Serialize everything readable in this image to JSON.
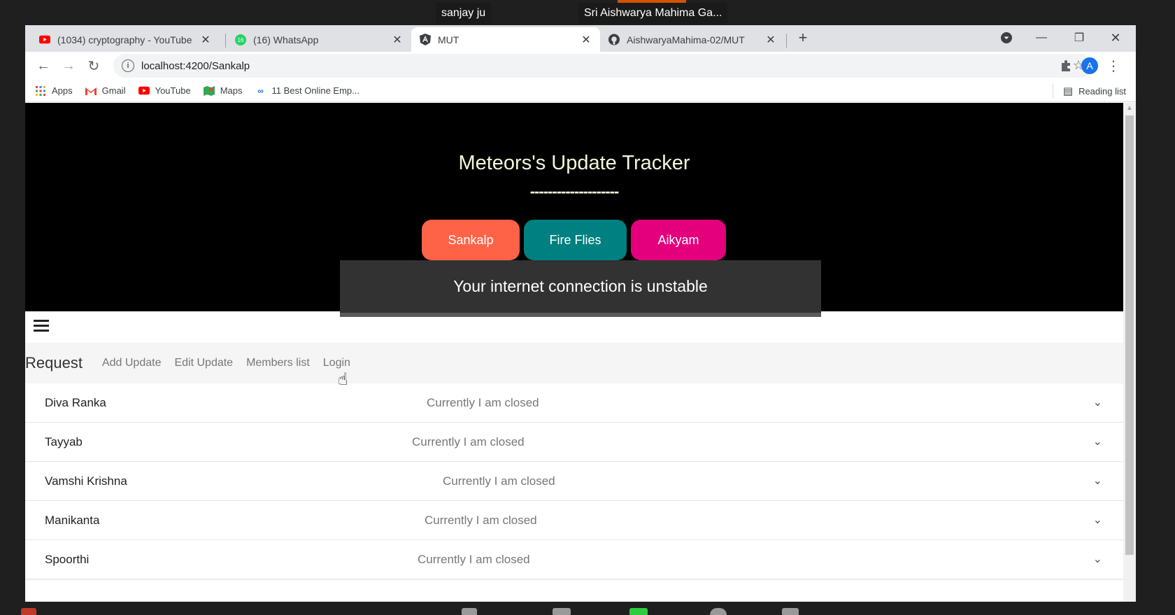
{
  "meeting": {
    "participant_left": "sanjay ju",
    "participant_right": "Sri Aishwarya Mahima Ga..."
  },
  "browser": {
    "tabs": [
      {
        "title": "(1034) cryptography - YouTube",
        "icon": "youtube-icon"
      },
      {
        "title": "(16) WhatsApp",
        "icon": "whatsapp-icon",
        "badge": "16"
      },
      {
        "title": "MUT",
        "icon": "angular-icon"
      },
      {
        "title": "AishwaryaMahima-02/MUT",
        "icon": "github-icon"
      }
    ],
    "url": "localhost:4200/Sankalp",
    "bookmarks": [
      "Apps",
      "Gmail",
      "YouTube",
      "Maps",
      "11 Best Online Emp..."
    ],
    "reading_list": "Reading list",
    "profile_initial": "A"
  },
  "page": {
    "title": "Meteors's Update Tracker",
    "divider": "--------------------",
    "teams": [
      {
        "label": "Sankalp",
        "color": "#ff6347"
      },
      {
        "label": "Fire Flies",
        "color": "#008080"
      },
      {
        "label": "Aikyam",
        "color": "#e4007c"
      }
    ],
    "toast": "Your internet connection is unstable",
    "nav": {
      "brand": "Request",
      "links": [
        "Add Update",
        "Edit Update",
        "Members list",
        "Login"
      ]
    },
    "members": [
      {
        "name": "Diva Ranka",
        "status": "Currently I am closed"
      },
      {
        "name": "Tayyab",
        "status": "Currently I am closed"
      },
      {
        "name": "Vamshi Krishna",
        "status": "Currently I am closed"
      },
      {
        "name": "Manikanta",
        "status": "Currently I am closed"
      },
      {
        "name": "Spoorthi",
        "status": "Currently I am closed"
      }
    ]
  }
}
